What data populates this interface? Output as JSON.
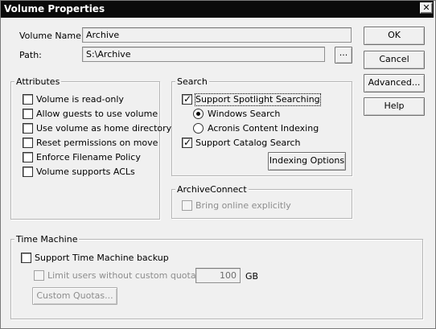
{
  "window": {
    "title": "Volume Properties",
    "close_glyph": "✕"
  },
  "fields": {
    "volume_name_label": "Volume Name:",
    "volume_name_value": "Archive",
    "path_label": "Path:",
    "path_value": "S:\\Archive",
    "browse_label": "..."
  },
  "buttons": {
    "ok": "OK",
    "cancel": "Cancel",
    "advanced": "Advanced...",
    "help": "Help"
  },
  "attributes": {
    "title": "Attributes",
    "items": [
      {
        "label": "Volume is read-only",
        "checked": false
      },
      {
        "label": "Allow guests to use volume",
        "checked": false
      },
      {
        "label": "Use volume as home directory",
        "checked": false
      },
      {
        "label": "Reset permissions on move",
        "checked": false
      },
      {
        "label": "Enforce Filename Policy",
        "checked": false
      },
      {
        "label": "Volume supports ACLs",
        "checked": false
      }
    ]
  },
  "search": {
    "title": "Search",
    "spotlight_label": "Support Spotlight Searching",
    "spotlight_checked": true,
    "radio_windows_label": "Windows Search",
    "radio_windows_selected": true,
    "radio_acronis_label": "Acronis Content Indexing",
    "radio_acronis_selected": false,
    "catalog_label": "Support Catalog Search",
    "catalog_checked": true,
    "indexing_button": "Indexing Options"
  },
  "archive_connect": {
    "title": "ArchiveConnect",
    "bring_online_label": "Bring online explicitly",
    "bring_online_checked": false
  },
  "time_machine": {
    "title": "Time Machine",
    "support_label": "Support Time Machine backup",
    "support_checked": false,
    "limit_label": "Limit users without custom quotas to:",
    "limit_checked": false,
    "limit_value": "100",
    "unit": "GB",
    "custom_quotas_button": "Custom Quotas..."
  },
  "check_glyph": "✓"
}
